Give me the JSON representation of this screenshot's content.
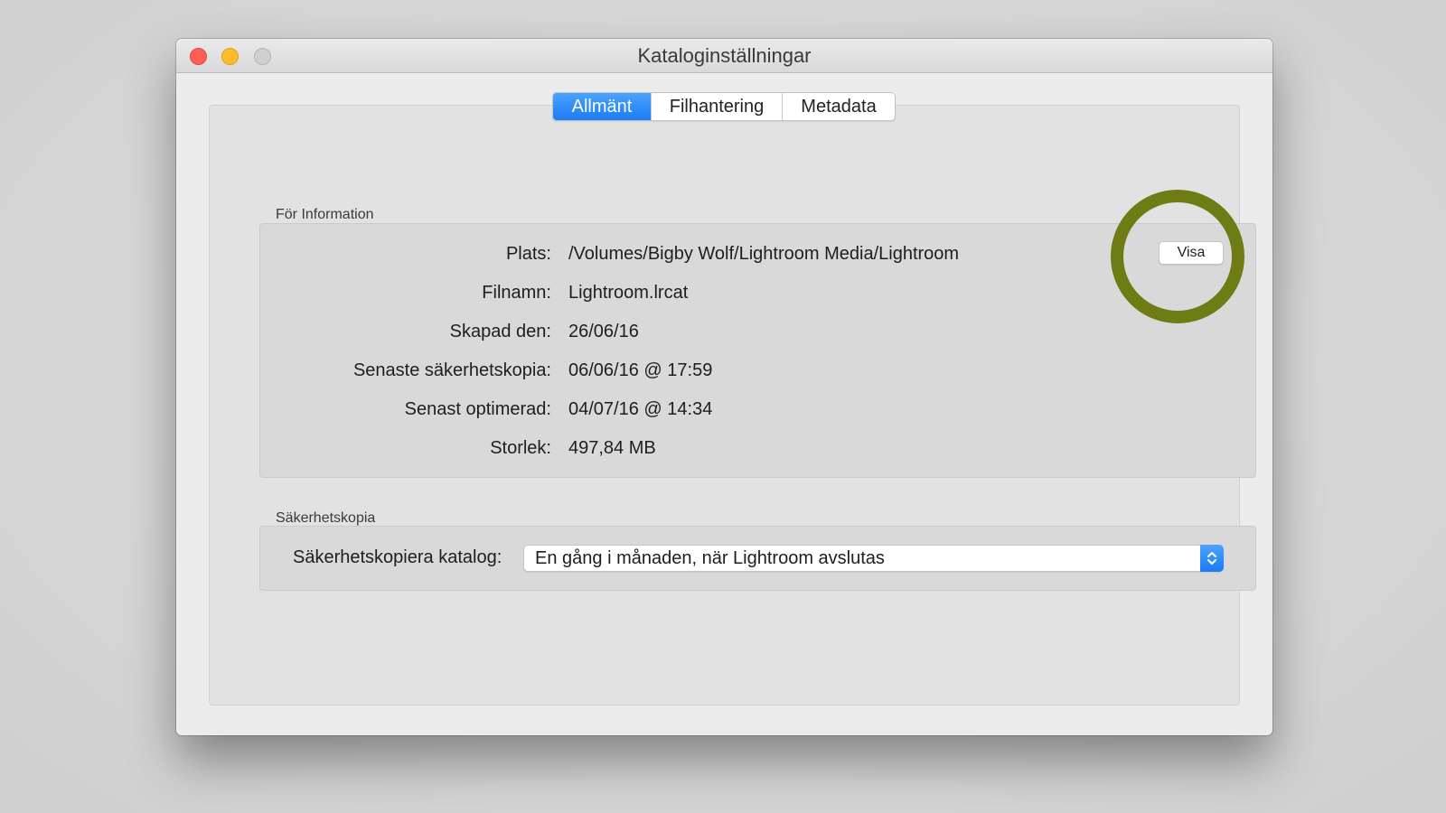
{
  "window": {
    "title": "Kataloginställningar"
  },
  "tabs": [
    {
      "label": "Allmänt",
      "selected": true
    },
    {
      "label": "Filhantering",
      "selected": false
    },
    {
      "label": "Metadata",
      "selected": false
    }
  ],
  "info": {
    "section_label": "För Information",
    "rows": [
      {
        "label": "Plats:",
        "value": "/Volumes/Bigby Wolf/Lightroom Media/Lightroom"
      },
      {
        "label": "Filnamn:",
        "value": "Lightroom.lrcat"
      },
      {
        "label": "Skapad den:",
        "value": "26/06/16"
      },
      {
        "label": "Senaste säkerhetskopia:",
        "value": "06/06/16 @ 17:59"
      },
      {
        "label": "Senast optimerad:",
        "value": "04/07/16 @ 14:34"
      },
      {
        "label": "Storlek:",
        "value": "497,84 MB"
      }
    ],
    "show_button_label": "Visa"
  },
  "backup": {
    "section_label": "Säkerhetskopia",
    "label": "Säkerhetskopiera katalog:",
    "selected_option": "En gång i månaden, när Lightroom avslutas"
  },
  "colors": {
    "accent": "#1b7cf2",
    "highlight_ring": "#6e7c16",
    "close": "#fc5f57",
    "minimize": "#fdbc2e"
  }
}
